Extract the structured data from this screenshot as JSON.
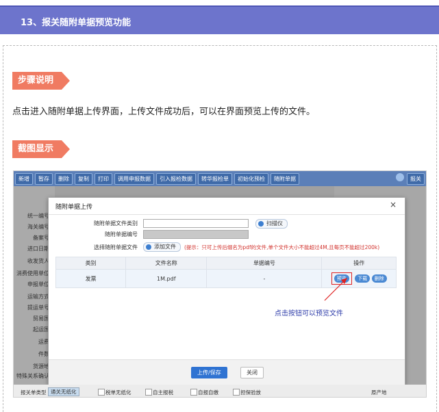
{
  "header": {
    "title": "13、报关随附单据预览功能"
  },
  "step_tag": {
    "label": "步骤说明"
  },
  "description": "点击进入随附单据上传界面，上传文件成功后，可以在界面预览上传的文件。",
  "screenshot_tag": {
    "label": "截图显示"
  },
  "app": {
    "toolbar": {
      "buttons": [
        "新增",
        "暂存",
        "删除",
        "复制",
        "打印",
        "调用申报数据",
        "引入报检数据",
        "转华报检单",
        "初始化预检",
        "随附单据"
      ],
      "right_button": "报关"
    },
    "form_labels": [
      "统一编号",
      "海关编号",
      "备案号",
      "进口日期",
      "收发货人",
      "消费使用单位",
      "申报单位",
      "运输方式",
      "提运单号",
      "贸易国",
      "起运国",
      "运费",
      "件数",
      "货源地",
      "特殊关系确认"
    ],
    "modal": {
      "title": "随附单据上传",
      "close": "×",
      "field1_label": "随附单据文件类别",
      "scan_button": "扫描仪",
      "field2_label": "随附单据编号",
      "field3_label": "选择随附单据文件",
      "add_file_button": "添加文件",
      "hint": "(提示：只可上传后缀名为pdf的文件,单个文件大小不能超过4M,且每页不能超过200k)",
      "table": {
        "headers": [
          "类别",
          "文件名称",
          "单据编号",
          "操作"
        ],
        "rows": [
          {
            "category": "发票",
            "filename": "1M.pdf",
            "doc_no": "-",
            "actions": [
              "预览",
              "下载",
              "删除"
            ]
          }
        ]
      },
      "annotation": "点击按钮可以预览文件",
      "upload_save_button": "上传/保存",
      "close_button": "关闭"
    },
    "bottom": {
      "declare_type_label": "报关单类型",
      "declare_type_value": "通关无纸化",
      "checkboxes": [
        "税单无纸化",
        "自主报税",
        "自报自缴",
        "担保验放"
      ],
      "right_text": "原产地"
    }
  }
}
